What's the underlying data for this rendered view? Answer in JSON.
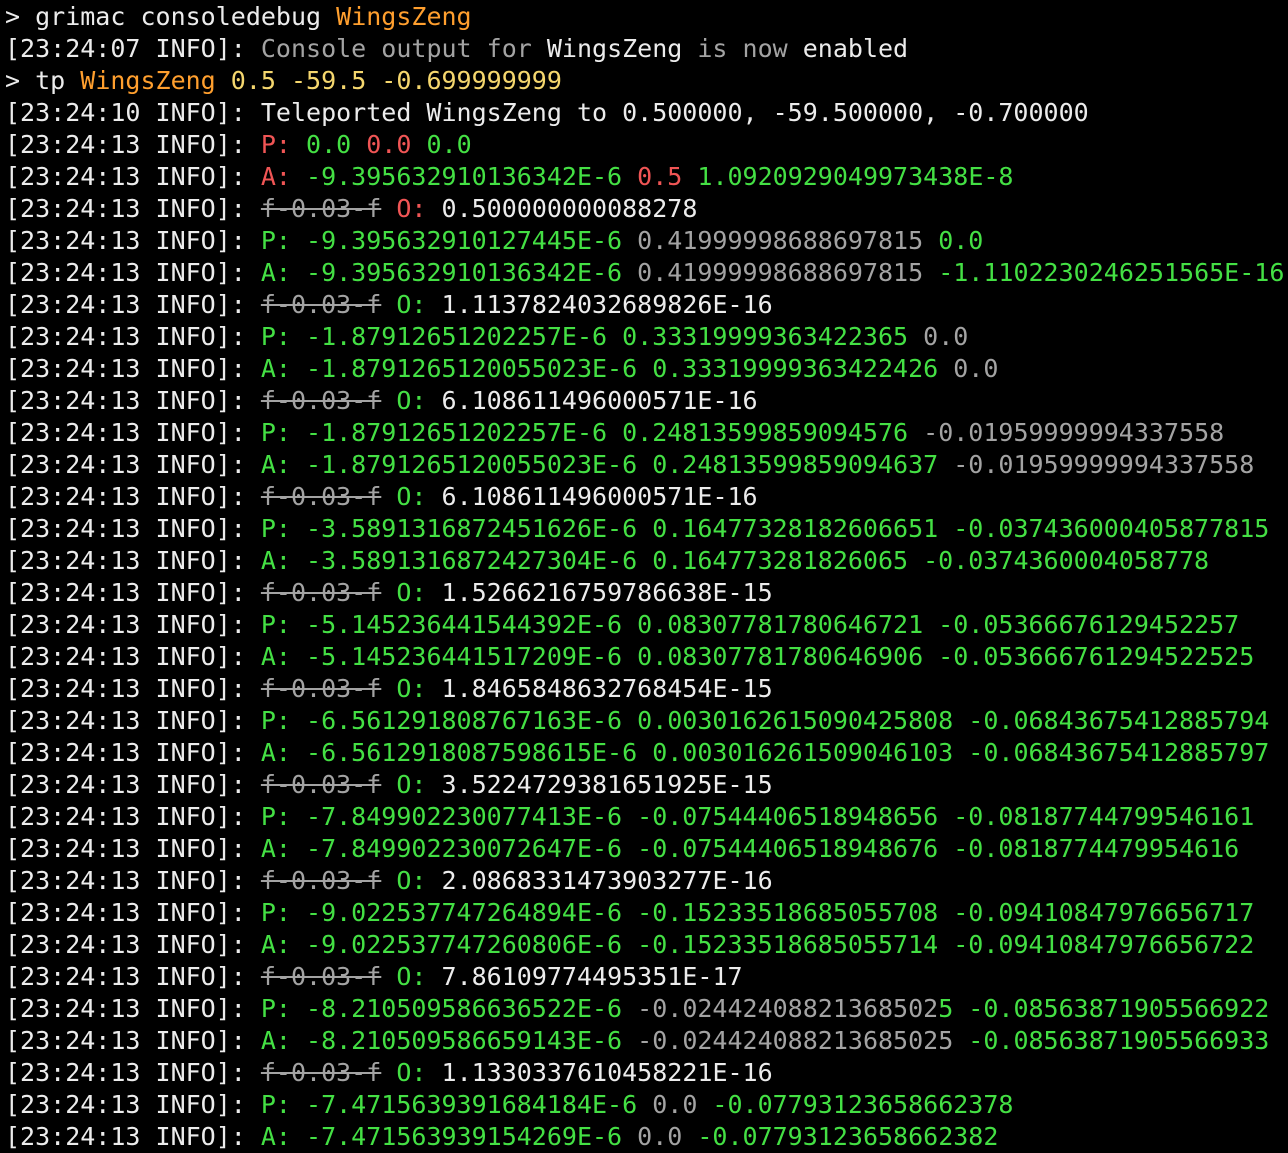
{
  "lines": [
    [
      {
        "t": "> grimac consoledebug ",
        "c": "w"
      },
      {
        "t": "WingsZeng",
        "c": "o"
      }
    ],
    [
      {
        "t": "[23:24:07 INFO]: ",
        "c": "w"
      },
      {
        "t": "Console output for ",
        "c": "d"
      },
      {
        "t": "WingsZeng",
        "c": "w"
      },
      {
        "t": " is now ",
        "c": "d"
      },
      {
        "t": "enabled",
        "c": "w"
      }
    ],
    [
      {
        "t": "> tp ",
        "c": "w"
      },
      {
        "t": "WingsZeng",
        "c": "o"
      },
      {
        "t": " 0.5 -59.5 -0.699999999",
        "c": "y"
      }
    ],
    [
      {
        "t": "[23:24:10 INFO]: Teleported WingsZeng to 0.500000, -59.500000, -0.700000",
        "c": "w"
      }
    ],
    [
      {
        "t": "[23:24:13 INFO]: ",
        "c": "w"
      },
      {
        "t": "P: ",
        "c": "r"
      },
      {
        "t": "0.0 ",
        "c": "g"
      },
      {
        "t": "0.0 ",
        "c": "r"
      },
      {
        "t": "0.0",
        "c": "g"
      }
    ],
    [
      {
        "t": "[23:24:13 INFO]: ",
        "c": "w"
      },
      {
        "t": "A: ",
        "c": "r"
      },
      {
        "t": "-9.395632910136342E-6 ",
        "c": "g"
      },
      {
        "t": "0.5 ",
        "c": "r"
      },
      {
        "t": "1.0920929049973438E-8",
        "c": "g"
      }
    ],
    [
      {
        "t": "[23:24:13 INFO]: ",
        "c": "w"
      },
      {
        "t": "f-0.03-f",
        "c": "s"
      },
      {
        "t": " O: ",
        "c": "r"
      },
      {
        "t": "0.500000000088278",
        "c": "w"
      }
    ],
    [
      {
        "t": "[23:24:13 INFO]: ",
        "c": "w"
      },
      {
        "t": "P: -9.395632910127445E-6 ",
        "c": "g"
      },
      {
        "t": "0.41999998688697815 ",
        "c": "d"
      },
      {
        "t": "0.0",
        "c": "g"
      }
    ],
    [
      {
        "t": "[23:24:13 INFO]: ",
        "c": "w"
      },
      {
        "t": "A: -9.395632910136342E-6 ",
        "c": "g"
      },
      {
        "t": "0.41999998688697815 ",
        "c": "d"
      },
      {
        "t": "-1.1102230246251565E-16",
        "c": "g"
      }
    ],
    [
      {
        "t": "[23:24:13 INFO]: ",
        "c": "w"
      },
      {
        "t": "f-0.03-f",
        "c": "s"
      },
      {
        "t": " O: ",
        "c": "g"
      },
      {
        "t": "1.1137824032689826E-16",
        "c": "w"
      }
    ],
    [
      {
        "t": "[23:24:13 INFO]: ",
        "c": "w"
      },
      {
        "t": "P: -1.87912651202257E-6 0.33319999363422365 ",
        "c": "g"
      },
      {
        "t": "0.0",
        "c": "d"
      }
    ],
    [
      {
        "t": "[23:24:13 INFO]: ",
        "c": "w"
      },
      {
        "t": "A: -1.8791265120055023E-6 0.33319999363422426 ",
        "c": "g"
      },
      {
        "t": "0.0",
        "c": "d"
      }
    ],
    [
      {
        "t": "[23:24:13 INFO]: ",
        "c": "w"
      },
      {
        "t": "f-0.03-f",
        "c": "s"
      },
      {
        "t": " O: ",
        "c": "g"
      },
      {
        "t": "6.108611496000571E-16",
        "c": "w"
      }
    ],
    [
      {
        "t": "[23:24:13 INFO]: ",
        "c": "w"
      },
      {
        "t": "P: -1.87912651202257E-6 0.24813599859094576 ",
        "c": "g"
      },
      {
        "t": "-0.01959999994337558",
        "c": "d"
      }
    ],
    [
      {
        "t": "[23:24:13 INFO]: ",
        "c": "w"
      },
      {
        "t": "A: -1.8791265120055023E-6 0.24813599859094637 ",
        "c": "g"
      },
      {
        "t": "-0.01959999994337558",
        "c": "d"
      }
    ],
    [
      {
        "t": "[23:24:13 INFO]: ",
        "c": "w"
      },
      {
        "t": "f-0.03-f",
        "c": "s"
      },
      {
        "t": " O: ",
        "c": "g"
      },
      {
        "t": "6.108611496000571E-16",
        "c": "w"
      }
    ],
    [
      {
        "t": "[23:24:13 INFO]: ",
        "c": "w"
      },
      {
        "t": "P: -3.5891316872451626E-6 0.16477328182606651 -0.037436000405877815",
        "c": "g"
      }
    ],
    [
      {
        "t": "[23:24:13 INFO]: ",
        "c": "w"
      },
      {
        "t": "A: -3.5891316872427304E-6 0.164773281826065 -0.0374360004058778",
        "c": "g"
      }
    ],
    [
      {
        "t": "[23:24:13 INFO]: ",
        "c": "w"
      },
      {
        "t": "f-0.03-f",
        "c": "s"
      },
      {
        "t": " O: ",
        "c": "g"
      },
      {
        "t": "1.5266216759786638E-15",
        "c": "w"
      }
    ],
    [
      {
        "t": "[23:24:13 INFO]: ",
        "c": "w"
      },
      {
        "t": "P: -5.145236441544392E-6 0.08307781780646721 -0.05366676129452257",
        "c": "g"
      }
    ],
    [
      {
        "t": "[23:24:13 INFO]: ",
        "c": "w"
      },
      {
        "t": "A: -5.145236441517209E-6 0.08307781780646906 -0.053666761294522525",
        "c": "g"
      }
    ],
    [
      {
        "t": "[23:24:13 INFO]: ",
        "c": "w"
      },
      {
        "t": "f-0.03-f",
        "c": "s"
      },
      {
        "t": " O: ",
        "c": "g"
      },
      {
        "t": "1.8465848632768454E-15",
        "c": "w"
      }
    ],
    [
      {
        "t": "[23:24:13 INFO]: ",
        "c": "w"
      },
      {
        "t": "P: -6.561291808767163E-6 0.0030162615090425808 -0.06843675412885794",
        "c": "g"
      }
    ],
    [
      {
        "t": "[23:24:13 INFO]: ",
        "c": "w"
      },
      {
        "t": "A: -6.5612918087598615E-6 0.003016261509046103 -0.06843675412885797",
        "c": "g"
      }
    ],
    [
      {
        "t": "[23:24:13 INFO]: ",
        "c": "w"
      },
      {
        "t": "f-0.03-f",
        "c": "s"
      },
      {
        "t": " O: ",
        "c": "g"
      },
      {
        "t": "3.5224729381651925E-15",
        "c": "w"
      }
    ],
    [
      {
        "t": "[23:24:13 INFO]: ",
        "c": "w"
      },
      {
        "t": "P: -7.849902230077413E-6 -0.07544406518948656 -0.08187744799546161",
        "c": "g"
      }
    ],
    [
      {
        "t": "[23:24:13 INFO]: ",
        "c": "w"
      },
      {
        "t": "A: -7.849902230072647E-6 -0.07544406518948676 -0.0818774479954616",
        "c": "g"
      }
    ],
    [
      {
        "t": "[23:24:13 INFO]: ",
        "c": "w"
      },
      {
        "t": "f-0.03-f",
        "c": "s"
      },
      {
        "t": " O: ",
        "c": "g"
      },
      {
        "t": "2.0868331473903277E-16",
        "c": "w"
      }
    ],
    [
      {
        "t": "[23:24:13 INFO]: ",
        "c": "w"
      },
      {
        "t": "P: -9.022537747264894E-6 -0.15233518685055708 -0.09410847976656717",
        "c": "g"
      }
    ],
    [
      {
        "t": "[23:24:13 INFO]: ",
        "c": "w"
      },
      {
        "t": "A: -9.022537747260806E-6 -0.15233518685055714 -0.09410847976656722",
        "c": "g"
      }
    ],
    [
      {
        "t": "[23:24:13 INFO]: ",
        "c": "w"
      },
      {
        "t": "f-0.03-f",
        "c": "s"
      },
      {
        "t": " O: ",
        "c": "g"
      },
      {
        "t": "7.86109774495351E-17",
        "c": "w"
      }
    ],
    [
      {
        "t": "[23:24:13 INFO]: ",
        "c": "w"
      },
      {
        "t": "P: -8.210509586636522E-6 ",
        "c": "g"
      },
      {
        "t": "-0.02442408821368502",
        "c": "d"
      },
      {
        "t": "5 -0.08563871905566922",
        "c": "g"
      }
    ],
    [
      {
        "t": "[23:24:13 INFO]: ",
        "c": "w"
      },
      {
        "t": "A: -8.210509586659143E-6 ",
        "c": "g"
      },
      {
        "t": "-0.024424088213685025",
        "c": "d"
      },
      {
        "t": " -0.08563871905566933",
        "c": "g"
      }
    ],
    [
      {
        "t": "[23:24:13 INFO]: ",
        "c": "w"
      },
      {
        "t": "f-0.03-f",
        "c": "s"
      },
      {
        "t": " O: ",
        "c": "g"
      },
      {
        "t": "1.1330337610458221E-16",
        "c": "w"
      }
    ],
    [
      {
        "t": "[23:24:13 INFO]: ",
        "c": "w"
      },
      {
        "t": "P: -7.4715639391684184E-6 ",
        "c": "g"
      },
      {
        "t": "0.0",
        "c": "d"
      },
      {
        "t": " -0.07793123658662378",
        "c": "g"
      }
    ],
    [
      {
        "t": "[23:24:13 INFO]: ",
        "c": "w"
      },
      {
        "t": "A: -7.471563939154269E-6 ",
        "c": "g"
      },
      {
        "t": "0.0",
        "c": "d"
      },
      {
        "t": " -0.07793123658662382",
        "c": "g"
      }
    ]
  ],
  "colors": {
    "background": "#000000",
    "white": "#ececec",
    "orange": "#ff9f2e",
    "yellow": "#f5d76e",
    "green": "#44e044",
    "red": "#f05555",
    "gray": "#a3a3a3"
  }
}
